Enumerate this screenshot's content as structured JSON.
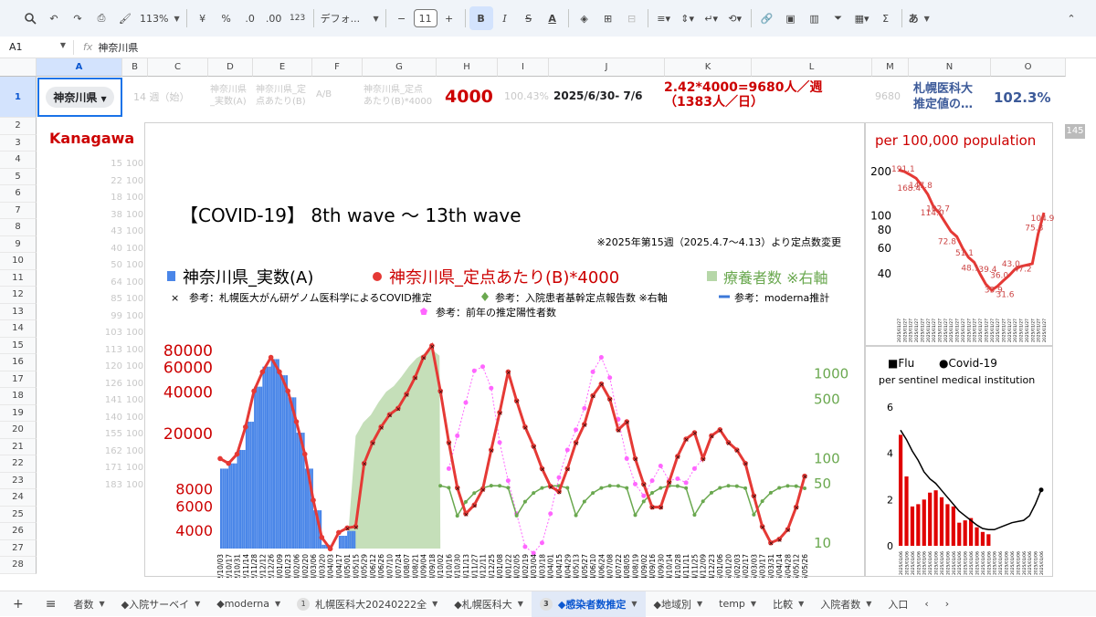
{
  "toolbar": {
    "zoom": "113%",
    "currency": "¥",
    "percent": "%",
    "dec_dec": ".0",
    "dec_inc": ".00",
    "number_format": "123",
    "font": "デフォ...",
    "font_size": "11",
    "bold": "B",
    "italic": "I",
    "sigma": "Σ",
    "ime": "あ"
  },
  "formula_bar": {
    "cell_ref": "A1",
    "fx": "fx",
    "value": "神奈川県"
  },
  "columns": [
    "A",
    "B",
    "C",
    "D",
    "E",
    "F",
    "G",
    "H",
    "I",
    "J",
    "K",
    "L",
    "M",
    "N",
    "O"
  ],
  "rows": [
    "1",
    "2",
    "3",
    "4",
    "5",
    "6",
    "7",
    "8",
    "9",
    "10",
    "11",
    "12",
    "13",
    "14",
    "15",
    "16",
    "17",
    "18",
    "19",
    "20",
    "21",
    "22",
    "23",
    "24",
    "25",
    "26",
    "27",
    "28"
  ],
  "row1": {
    "a1_value": "神奈川県",
    "c1": "14 週（始）",
    "d1": "神奈川県\n_実数(A)",
    "e1": "神奈川県_定\n点あたり(B)",
    "f1": "A/B",
    "g1": "神奈川県_定点\nあたり(B)*4000",
    "h1": "4000",
    "i1": "100.43%",
    "j1": "2025/6/30- 7/6",
    "k1": "2.42*4000=9680人／週\n（1383人／日）",
    "m1": "9680",
    "n1": "札幌医科大\n推定値の…",
    "o1": "102.3%"
  },
  "kanagawa_label": "Kanagawa",
  "side_values": [
    "15",
    "22",
    "18",
    "38",
    "43",
    "40",
    "50",
    "64",
    "85",
    "99",
    "103",
    "113",
    "120",
    "126",
    "141",
    "140",
    "155",
    "162",
    "171",
    "183"
  ],
  "side_values_b": [
    "100",
    "100",
    "100",
    "100",
    "100",
    "100",
    "100",
    "100",
    "100",
    "100",
    "100",
    "100",
    "100",
    "100",
    "100",
    "100",
    "100",
    "100",
    "100",
    "100"
  ],
  "scroll_badge": "145",
  "main_chart": {
    "title": "【COVID-19】 8th wave 〜 13th wave",
    "note": "※2025年第15週（2025.4.7〜4.13）より定点数変更",
    "legend_a": "神奈川県_実数(A)",
    "legend_b": "神奈川県_定点あたり(B)*4000",
    "legend_c": "療養者数 ※右軸",
    "legend_d": "参考：札幌医大がん研ゲノム医科学によるCOVID推定",
    "legend_e": "参考：入院患者基幹定点報告数 ※右軸",
    "legend_f": "参考：moderna推計",
    "legend_g": "参考：前年の推定陽性者数",
    "colors": {
      "bar": "#4a86e8",
      "line": "#e53935",
      "area": "#b6d7a8",
      "green": "#6aa84f",
      "pink": "#ff66ff"
    }
  },
  "chart_data": [
    {
      "type": "line",
      "title": "【COVID-19】 8th wave 〜 13th wave",
      "yscale": "log",
      "left_ticks": [
        "80000",
        "60000",
        "40000",
        "20000",
        "8000",
        "6000",
        "4000"
      ],
      "right_ticks": [
        "1000",
        "500",
        "100",
        "50",
        "10"
      ],
      "x": [
        "2022/10/03",
        "2022/10/17",
        "2022/10/31",
        "2022/11/14",
        "2022/11/28",
        "2022/12/12",
        "2022/12/26",
        "2023/01/09",
        "2023/01/23",
        "2023/02/06",
        "2023/02/20",
        "2023/03/06",
        "2023/03/20",
        "2023/04/03",
        "2023/04/17",
        "2023/05/01",
        "2023/05/15",
        "2023/05/29",
        "2023/06/12",
        "2023/06/26",
        "2023/07/10",
        "2023/07/24",
        "2023/08/07",
        "2023/08/21",
        "2023/09/04",
        "2023/09/18",
        "2023/10/02",
        "2023/10/16",
        "2023/10/30",
        "2023/11/13",
        "2023/11/27",
        "2023/12/11",
        "2023/12/25",
        "2024/01/08",
        "2024/01/22",
        "2024/02/05",
        "2024/02/19",
        "2024/03/04",
        "2024/03/18",
        "2024/04/01",
        "2024/04/15",
        "2024/04/29",
        "2024/05/13",
        "2024/05/27",
        "2024/06/10",
        "2024/06/24",
        "2024/07/08",
        "2024/07/22",
        "2024/08/05",
        "2024/08/19",
        "2024/09/02",
        "2024/09/16",
        "2024/09/30",
        "2024/10/14",
        "2024/10/28",
        "2024/11/11",
        "2024/11/25",
        "2024/12/09",
        "2024/12/23",
        "2025/01/06",
        "2025/01/20",
        "2025/02/03",
        "2025/02/17",
        "2025/03/03",
        "2025/03/17",
        "2025/03/31",
        "2025/04/14",
        "2025/04/28",
        "2025/05/12",
        "2025/05/26",
        "2025/06/09",
        "2025/06/23"
      ],
      "series": [
        {
          "name": "神奈川県_定点あたり(B)*4000",
          "values": [
            13000,
            12000,
            14000,
            22000,
            40000,
            55000,
            70000,
            55000,
            40000,
            24000,
            14000,
            6500,
            3500,
            2900,
            3800,
            4100,
            4200,
            12000,
            17000,
            22000,
            27000,
            30000,
            38000,
            50000,
            70000,
            85000,
            40000,
            17000,
            8000,
            5200,
            6000,
            7800,
            15000,
            28000,
            55000,
            34000,
            22000,
            16000,
            11000,
            8200,
            7500,
            11000,
            17000,
            23000,
            37000,
            45000,
            35000,
            21000,
            24000,
            13000,
            8500,
            5800,
            5800,
            8800,
            13500,
            18000,
            20000,
            13000,
            19000,
            21000,
            17000,
            15000,
            12000,
            7000,
            4200,
            3200,
            3400,
            4000,
            5800,
            9700
          ]
        },
        {
          "name": "神奈川県_実数(A)",
          "values": [
            11000,
            12000,
            15000,
            24000,
            43000,
            60000,
            68000,
            52000,
            36000,
            20000,
            11000,
            5500,
            3100,
            2700,
            3600,
            3900
          ]
        },
        {
          "name": "前年の推定陽性者数",
          "values": [
            null,
            null,
            null,
            null,
            null,
            null,
            null,
            null,
            null,
            null,
            null,
            null,
            null,
            null,
            null,
            null,
            null,
            null,
            null,
            null,
            null,
            null,
            null,
            null,
            null,
            null,
            null,
            11000,
            19000,
            33000,
            56000,
            60000,
            42000,
            17000,
            9000,
            5200,
            3000,
            2700,
            3200,
            5200,
            9500,
            15000,
            21000,
            30000,
            55000,
            70000,
            50000,
            25000,
            13000,
            8500,
            7000,
            9000,
            11500,
            9000,
            9300,
            8700,
            11000,
            13000
          ]
        }
      ]
    },
    {
      "type": "line",
      "title": "per 100,000 population",
      "yscale": "log",
      "y_ticks": [
        "200",
        "100",
        "80",
        "60",
        "40"
      ],
      "labels": [
        "191.1",
        "168.4",
        "147.8",
        "114.0",
        "102.7",
        "72.8",
        "51.1",
        "48.1",
        "39.4",
        "33.9",
        "36.0",
        "31.6",
        "43.0",
        "47.2",
        "75.8",
        "104.9"
      ]
    },
    {
      "type": "bar",
      "title": "per sentinel medical institution",
      "legend": [
        "Flu",
        "Covid-19"
      ],
      "y_ticks": [
        "6",
        "4",
        "2",
        "0"
      ],
      "series": [
        {
          "name": "Flu",
          "values": [
            4.8,
            3.0,
            1.7,
            1.8,
            2.0,
            2.3,
            2.4,
            2.1,
            1.8,
            1.7,
            1.0,
            1.1,
            1.2,
            0.8,
            0.6,
            0.5
          ]
        },
        {
          "name": "Covid-19",
          "values": [
            5.0,
            4.6,
            4.1,
            3.7,
            3.2,
            2.9,
            2.7,
            2.4,
            2.1,
            1.8,
            1.5,
            1.3,
            1.1,
            0.9,
            0.75,
            0.7,
            0.7,
            0.8,
            0.9,
            1.0,
            1.05,
            1.1,
            1.3,
            1.8,
            2.42
          ]
        }
      ]
    }
  ],
  "mini_chart": {
    "title": "per 100,000 population"
  },
  "flu_chart": {
    "legend_flu": "■Flu",
    "legend_covid": "●Covid-19",
    "subtitle": "per sentinel medical institution"
  },
  "tabs": [
    {
      "label": "者数"
    },
    {
      "label": "◆入院サーベイ"
    },
    {
      "label": "◆moderna"
    },
    {
      "label": "札幌医科大20240222全",
      "badge": "1"
    },
    {
      "label": "◆札幌医科大"
    },
    {
      "label": "◆感染者数推定",
      "badge": "3",
      "active": true
    },
    {
      "label": "◆地域別"
    },
    {
      "label": "temp"
    },
    {
      "label": "比較"
    },
    {
      "label": "入院者数"
    },
    {
      "label": "入口"
    }
  ]
}
